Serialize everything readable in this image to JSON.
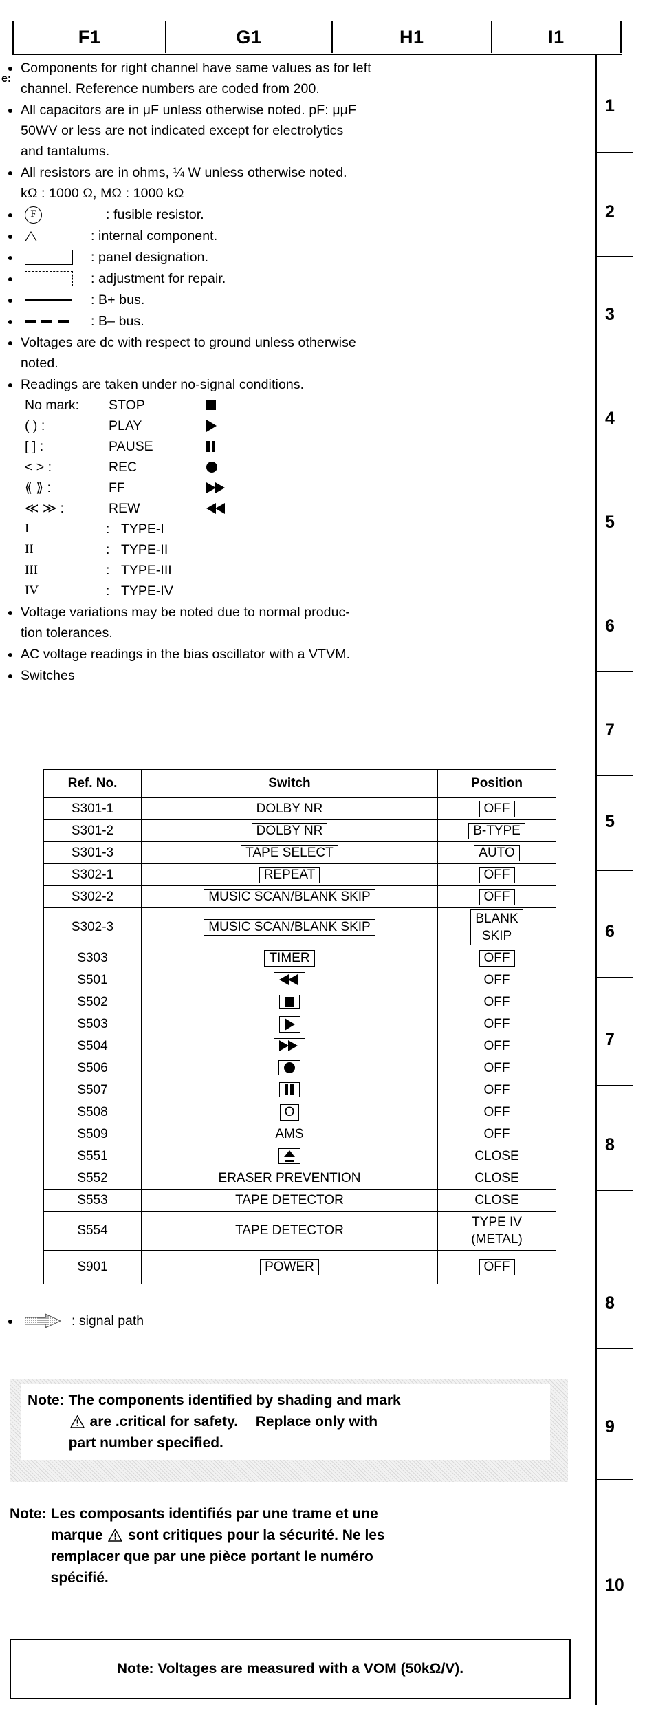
{
  "grid": {
    "columns": [
      "F1",
      "G1",
      "H1",
      "I1"
    ],
    "rows": [
      "1",
      "2",
      "3",
      "4",
      "5",
      "6",
      "7",
      "8",
      "9",
      "10"
    ]
  },
  "notes_label": "e:",
  "notes": {
    "components": {
      "line1": "Components for right channel have same values as for left",
      "line2": "channel. Reference numbers are coded from 200."
    },
    "capacitors": {
      "line1": "All capacitors are in μF unless otherwise noted. pF: μμF",
      "line2": "50WV or less are not indicated except for electrolytics",
      "line3": "and tantalums."
    },
    "resistors": {
      "line1": "All resistors are in ohms, ¼ W unless otherwise noted.",
      "line2": "kΩ : 1000 Ω, MΩ : 1000 kΩ"
    },
    "fusible": {
      "symbol": "F",
      "text": ": fusible resistor."
    },
    "internal": {
      "text": ": internal component."
    },
    "panel": {
      "text": ": panel designation."
    },
    "adjustment": {
      "text": ": adjustment for repair."
    },
    "bplus": {
      "text": ": B+ bus."
    },
    "bminus": {
      "text": ": B– bus."
    },
    "voltages": {
      "line1": "Voltages are dc with respect to ground unless otherwise",
      "line2": "noted."
    },
    "readings": {
      "line1": "Readings are taken under no-signal conditions."
    },
    "modes": [
      {
        "mark": "No mark:",
        "name": "STOP",
        "glyph": "stop-icon"
      },
      {
        "mark": "(    )",
        "sep": ":",
        "name": "PLAY",
        "glyph": "play-icon"
      },
      {
        "mark": "[    ]",
        "sep": ":",
        "name": "PAUSE",
        "glyph": "pause-icon"
      },
      {
        "mark": "<    >",
        "sep": ":",
        "name": "REC",
        "glyph": "record-icon"
      },
      {
        "mark": "⟪    ⟫",
        "sep": ":",
        "name": "FF",
        "glyph": "fast-forward-icon"
      },
      {
        "mark": "≪  ≫",
        "sep": ":",
        "name": "REW",
        "glyph": "rewind-icon"
      }
    ],
    "types": [
      {
        "mark": "I",
        "sep": ":",
        "name": "TYPE-I"
      },
      {
        "mark": "II",
        "sep": ":",
        "name": "TYPE-II"
      },
      {
        "mark": "III",
        "sep": ":",
        "name": "TYPE-III"
      },
      {
        "mark": "IV",
        "sep": ":",
        "name": "TYPE-IV"
      }
    ],
    "variations": {
      "line1": "Voltage variations may be noted due to normal produc-",
      "line2": "tion tolerances."
    },
    "ac_reading": {
      "line1": "AC voltage readings in the bias oscillator with a VTVM."
    },
    "switches_label": "Switches",
    "signal_path": ": signal path"
  },
  "switch_table": {
    "headers": [
      "Ref. No.",
      "Switch",
      "Position"
    ],
    "rows": [
      {
        "ref": "S301-1",
        "switch": "DOLBY NR",
        "switch_style": "boxed",
        "position": "OFF",
        "position_style": "boxed"
      },
      {
        "ref": "S301-2",
        "switch": "DOLBY NR",
        "switch_style": "boxed",
        "position": "B-TYPE",
        "position_style": "boxed"
      },
      {
        "ref": "S301-3",
        "switch": "TAPE SELECT",
        "switch_style": "boxed",
        "position": "AUTO",
        "position_style": "boxed"
      },
      {
        "ref": "S302-1",
        "switch": "REPEAT",
        "switch_style": "boxed",
        "position": "OFF",
        "position_style": "boxed"
      },
      {
        "ref": "S302-2",
        "switch": "MUSIC SCAN/BLANK SKIP",
        "switch_style": "boxed",
        "position": "OFF",
        "position_style": "boxed"
      },
      {
        "ref": "S302-3",
        "switch": "MUSIC SCAN/BLANK SKIP",
        "switch_style": "boxed",
        "position": "BLANK SKIP",
        "position_style": "boxed-two"
      },
      {
        "ref": "S303",
        "switch": "TIMER",
        "switch_style": "boxed",
        "position": "OFF",
        "position_style": "boxed"
      },
      {
        "ref": "S501",
        "switch": "rewind-icon",
        "switch_style": "icon",
        "position": "OFF",
        "position_style": "plain"
      },
      {
        "ref": "S502",
        "switch": "stop-icon",
        "switch_style": "icon",
        "position": "OFF",
        "position_style": "plain"
      },
      {
        "ref": "S503",
        "switch": "play-icon",
        "switch_style": "icon",
        "position": "OFF",
        "position_style": "plain"
      },
      {
        "ref": "S504",
        "switch": "fast-forward-icon",
        "switch_style": "icon",
        "position": "OFF",
        "position_style": "plain"
      },
      {
        "ref": "S506",
        "switch": "record-icon",
        "switch_style": "icon",
        "position": "OFF",
        "position_style": "plain"
      },
      {
        "ref": "S507",
        "switch": "pause-icon",
        "switch_style": "icon",
        "position": "OFF",
        "position_style": "plain"
      },
      {
        "ref": "S508",
        "switch": "O",
        "switch_style": "icon-text",
        "position": "OFF",
        "position_style": "plain"
      },
      {
        "ref": "S509",
        "switch": "AMS",
        "switch_style": "plain",
        "position": "OFF",
        "position_style": "plain"
      },
      {
        "ref": "S551",
        "switch": "eject-icon",
        "switch_style": "icon",
        "position": "CLOSE",
        "position_style": "plain"
      },
      {
        "ref": "S552",
        "switch": "ERASER PREVENTION",
        "switch_style": "plain",
        "position": "CLOSE",
        "position_style": "plain"
      },
      {
        "ref": "S553",
        "switch": "TAPE DETECTOR",
        "switch_style": "plain",
        "position": "CLOSE",
        "position_style": "plain"
      },
      {
        "ref": "S554",
        "switch": "TAPE DETECTOR",
        "switch_style": "plain",
        "position": "TYPE IV (METAL)",
        "position_style": "plain-two"
      },
      {
        "ref": "S901",
        "switch": "POWER",
        "switch_style": "boxed",
        "position": "OFF",
        "position_style": "boxed"
      }
    ]
  },
  "safety_note_en": {
    "key": "Note:",
    "line1": "The components identified by shading and mark",
    "line2_a": "are .critical for safety.",
    "line2_b": "Replace only with",
    "line3": "part number specified."
  },
  "safety_note_fr": {
    "key": "Note:",
    "line1": "Les composants identifiés par une trame et une",
    "line2_a": "marque",
    "line2_b": "sont critiques pour la sécurité. Ne les",
    "line3": "remplacer que par une pièce portant le numéro",
    "line4": "spécifié."
  },
  "vom_note": {
    "text": "Note:  Voltages are measured with a VOM (50kΩ/V)."
  }
}
